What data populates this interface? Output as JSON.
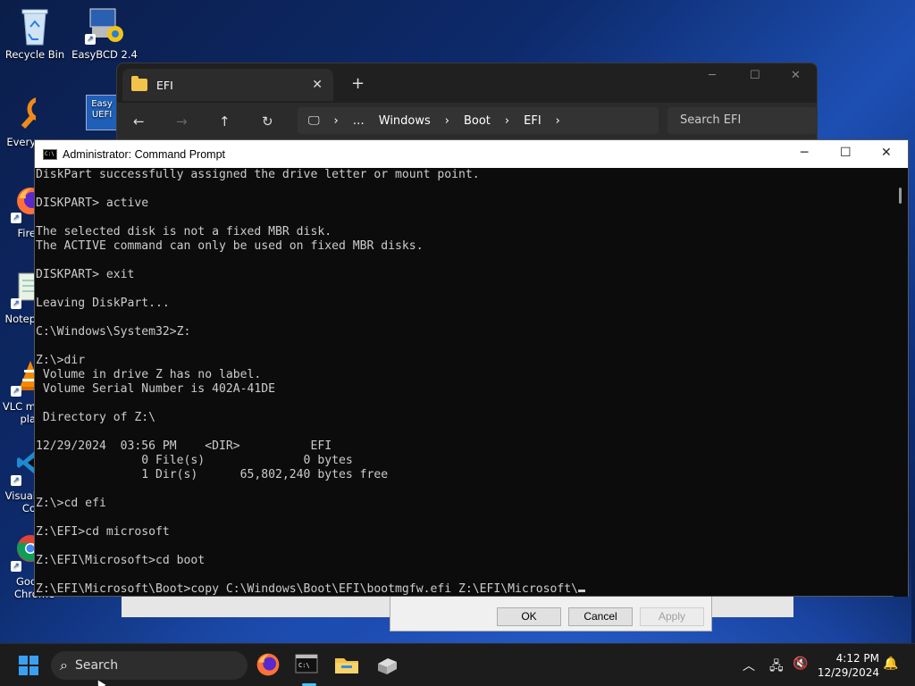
{
  "desktop": {
    "icons": [
      {
        "label": "Recycle Bin",
        "icon": "recycle-bin-icon"
      },
      {
        "label": "EasyBCD 2.4",
        "icon": "easybcd-icon"
      },
      {
        "label": "Every",
        "icon": "everything-search-icon"
      },
      {
        "label": "Fire",
        "icon": "firefox-icon"
      },
      {
        "label": "Notep",
        "icon": "notepad-icon"
      },
      {
        "label": "VLC m",
        "label2": "pla",
        "icon": "vlc-icon"
      },
      {
        "label": "Visual",
        "label2": "Co",
        "icon": "vscode-icon"
      },
      {
        "label": "Goo",
        "label2": "Chrome",
        "icon": "chrome-icon"
      }
    ],
    "easyuefi_partial_label": "Easy UEFI"
  },
  "explorer": {
    "tab_title": "EFI",
    "new_tab": "+",
    "close_tab": "✕",
    "breadcrumb": [
      "…",
      "Windows",
      "Boot",
      "EFI"
    ],
    "search_placeholder": "Search EFI"
  },
  "cmd": {
    "title": "Administrator: Command Prompt",
    "icon_text": "C:\\",
    "lines": [
      "DiskPart successfully assigned the drive letter or mount point.",
      "",
      "DISKPART> active",
      "",
      "The selected disk is not a fixed MBR disk.",
      "The ACTIVE command can only be used on fixed MBR disks.",
      "",
      "DISKPART> exit",
      "",
      "Leaving DiskPart...",
      "",
      "C:\\Windows\\System32>Z:",
      "",
      "Z:\\>dir",
      " Volume in drive Z has no label.",
      " Volume Serial Number is 402A-41DE",
      "",
      " Directory of Z:\\",
      "",
      "12/29/2024  03:56 PM    <DIR>          EFI",
      "               0 File(s)              0 bytes",
      "               1 Dir(s)      65,802,240 bytes free",
      "",
      "Z:\\>cd efi",
      "",
      "Z:\\EFI>cd microsoft",
      "",
      "Z:\\EFI\\Microsoft>cd boot",
      "",
      "Z:\\EFI\\Microsoft\\Boot>copy C:\\Windows\\Boot\\EFI\\bootmgfw.efi Z:\\EFI\\Microsoft\\"
    ]
  },
  "dialog": {
    "ok": "OK",
    "cancel": "Cancel",
    "apply": "Apply"
  },
  "taskbar": {
    "search_label": "Search",
    "apps": [
      "firefox-icon",
      "terminal-icon",
      "file-explorer-icon",
      "usb-drive-icon"
    ],
    "time": "4:12 PM",
    "date": "12/29/2024"
  },
  "colors": {
    "console_bg": "#0c0c0c",
    "console_fg": "#cccccc",
    "accent": "#4cc2ff"
  }
}
